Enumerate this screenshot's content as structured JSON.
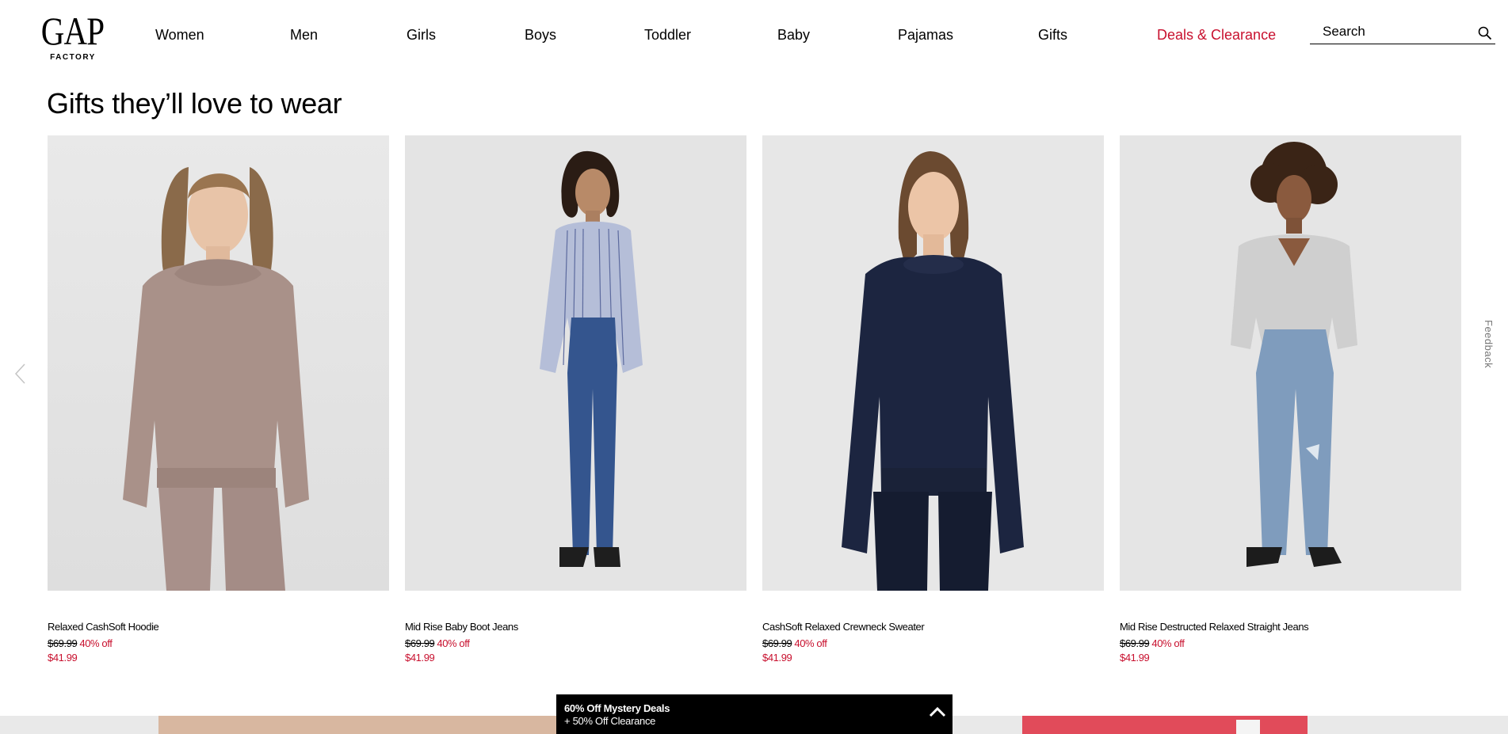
{
  "header": {
    "logo": {
      "main": "GAP",
      "sub": "FACTORY"
    },
    "nav": [
      {
        "label": "Women",
        "name": "nav-women"
      },
      {
        "label": "Men",
        "name": "nav-men"
      },
      {
        "label": "Girls",
        "name": "nav-girls"
      },
      {
        "label": "Boys",
        "name": "nav-boys"
      },
      {
        "label": "Toddler",
        "name": "nav-toddler"
      },
      {
        "label": "Baby",
        "name": "nav-baby"
      },
      {
        "label": "Pajamas",
        "name": "nav-pajamas"
      },
      {
        "label": "Gifts",
        "name": "nav-gifts"
      },
      {
        "label": "Deals & Clearance",
        "name": "nav-deals-clearance"
      }
    ],
    "search": {
      "placeholder": "Search",
      "icon": "search-icon"
    }
  },
  "section": {
    "title": "Gifts they’ll love to wear"
  },
  "products": [
    {
      "name": "Relaxed CashSoft Hoodie",
      "original_price": "$69.99",
      "discount": "40% off",
      "sale_price": "$41.99"
    },
    {
      "name": "Mid Rise Baby Boot Jeans",
      "original_price": "$69.99",
      "discount": "40% off",
      "sale_price": "$41.99"
    },
    {
      "name": "CashSoft Relaxed Crewneck Sweater",
      "original_price": "$69.99",
      "discount": "40% off",
      "sale_price": "$41.99"
    },
    {
      "name": "Mid Rise Destructed Relaxed Straight Jeans",
      "original_price": "$69.99",
      "discount": "40% off",
      "sale_price": "$41.99"
    }
  ],
  "feedback": {
    "label": "Feedback"
  },
  "promo": {
    "line1": "60% Off Mystery Deals",
    "line2": "+ 50% Off Clearance",
    "icon": "chevron-up-icon"
  },
  "colors": {
    "deals": "#c8102e",
    "price_red": "#c8102e",
    "promo_bg": "#000000"
  }
}
